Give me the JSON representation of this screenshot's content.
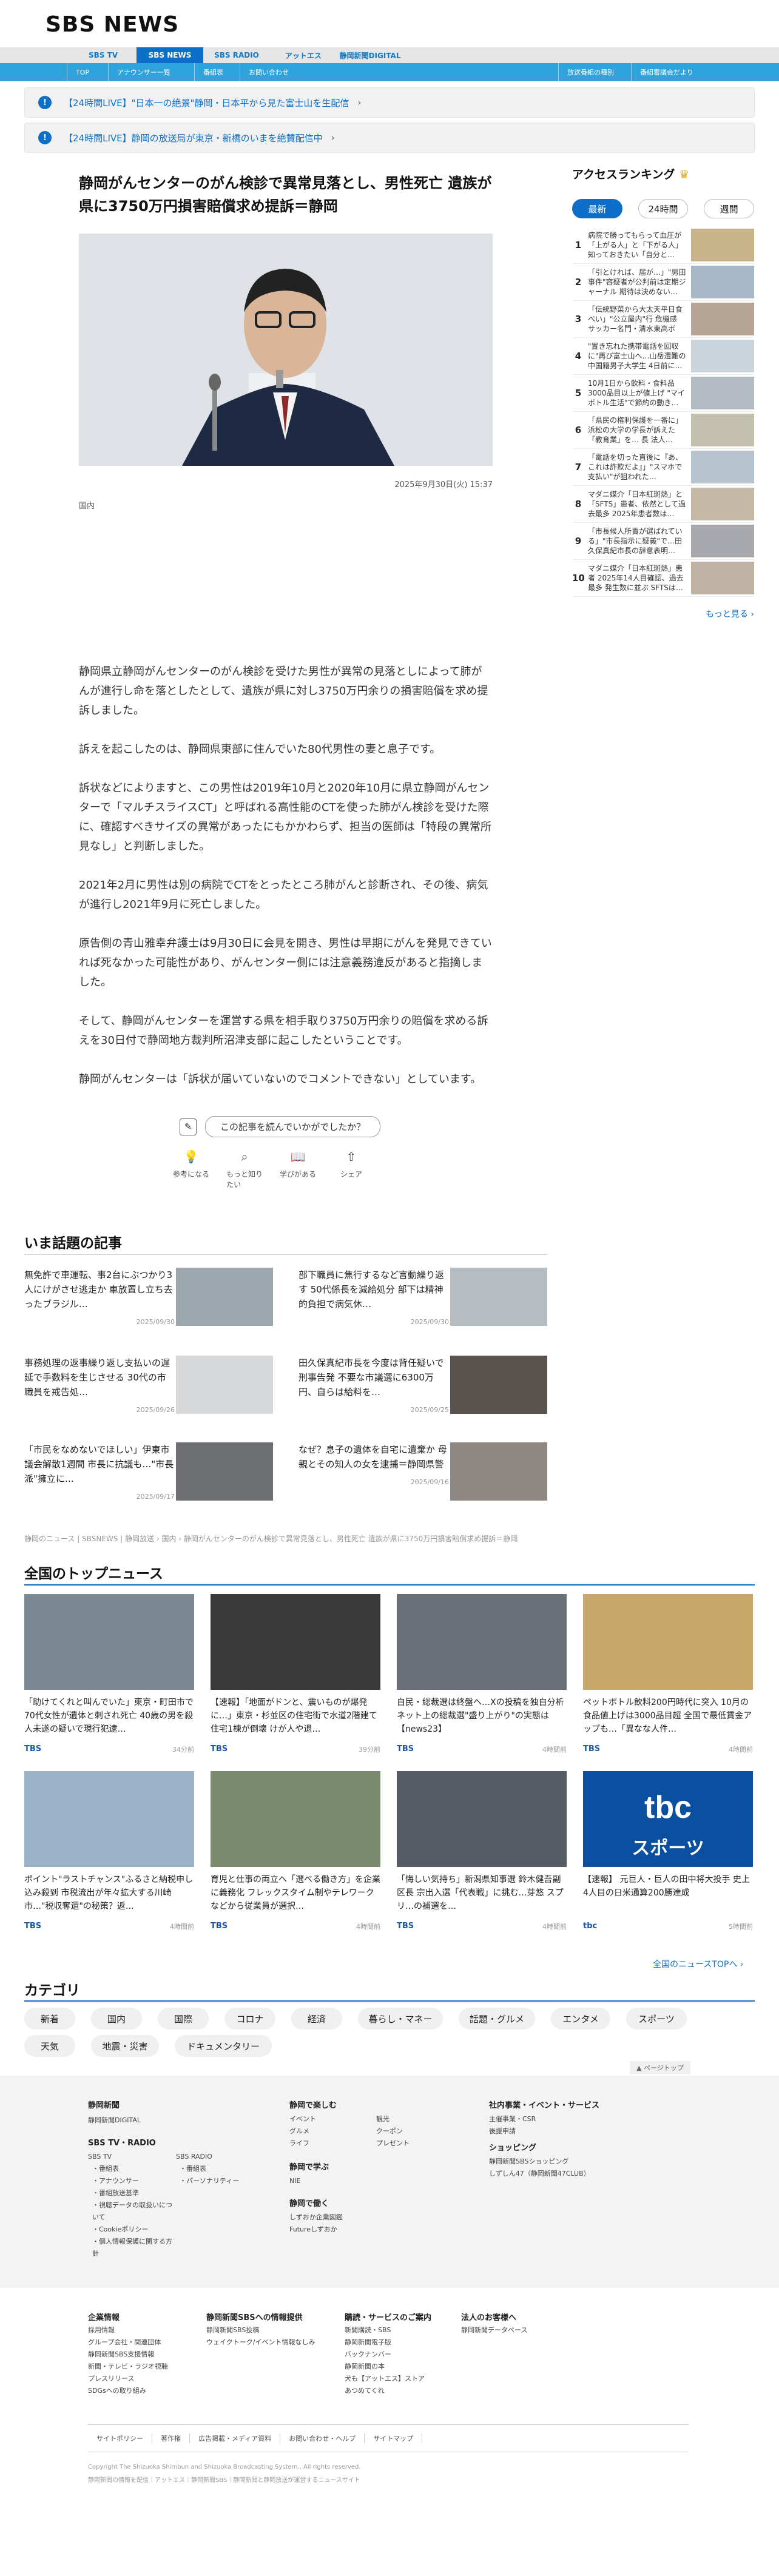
{
  "logo": "SBS NEWS",
  "nav1": [
    "SBS TV",
    "SBS NEWS",
    "SBS RADIO",
    "アットエス",
    "静岡新聞DIGITAL"
  ],
  "nav2": {
    "left": [
      "TOP",
      "アナウンサー一覧",
      "番組表",
      "お問い合わせ"
    ],
    "right": [
      "放送番組の種別",
      "番組審議会だより"
    ]
  },
  "alerts": [
    "【24時間LIVE】\"日本一の絶景\"静岡・日本平から見た富士山を生配信",
    "【24時間LIVE】静岡の放送局が東京・新橋のいまを絶賛配信中"
  ],
  "article": {
    "title": "静岡がんセンターのがん検診で異常見落とし、男性死亡 遺族が県に3750万円損害賠償求め提訴＝静岡",
    "date": "2025年9月30日(火) 15:37",
    "category": "国内",
    "paragraphs": [
      "静岡県立静岡がんセンターのがん検診を受けた男性が異常の見落としによって肺がんが進行し命を落としたとして、遺族が県に対し3750万円余りの損害賠償を求め提訴しました。",
      "訴えを起こしたのは、静岡県東部に住んでいた80代男性の妻と息子です。",
      "訴状などによりますと、この男性は2019年10月と2020年10月に県立静岡がんセンターで「マルチスライスCT」と呼ばれる高性能のCTを使った肺がん検診を受けた際に、確認すべきサイズの異常があったにもかかわらず、担当の医師は「特段の異常所見なし」と判断しました。",
      "2021年2月に男性は別の病院でCTをとったところ肺がんと診断され、その後、病気が進行し2021年9月に死亡しました。",
      "原告側の青山雅幸弁護士は9月30日に会見を開き、男性は早期にがんを発見できていれば死なかった可能性があり、がんセンター側には注意義務違反があると指摘しました。",
      "そして、静岡がんセンターを運営する県を相手取り3750万円余りの賠償を求める訴えを30日付で静岡地方裁判所沼津支部に起こしたということです。",
      "静岡がんセンターは「訴状が届いていないのでコメントできない」としています。"
    ],
    "feedback": "この記事を読んでいかがでしたか？",
    "reactions": [
      "参考になる",
      "もっと知りたい",
      "学びがある",
      "シェア"
    ]
  },
  "ranking": {
    "heading": "アクセスランキング",
    "tabs": [
      "最新",
      "24時間",
      "週間"
    ],
    "items": [
      {
        "no": "1",
        "title": "病院で勝ってもらって血圧が「上がる人」と「下がる人」知っておきたい「自分と…"
      },
      {
        "no": "2",
        "title": "「引とければ、届が…」\"男田事件\"容疑者が公判前は定期ジャーナル 期待は決めない…"
      },
      {
        "no": "3",
        "title": "「伝統野菜から大太天平日食べい」\"公立屋内\"行 危機感 サッカー名門・清水東高ボジ…"
      },
      {
        "no": "4",
        "title": "\"置き忘れた携帯電話を回収に\"再び富士山へ…山岳遭難の中国籍男子大学生 4日前に…"
      },
      {
        "no": "5",
        "title": "10月1日から飲料・食料品3000品目以上が値上げ \"マイボトル生活\"で節約の動き…"
      },
      {
        "no": "6",
        "title": "「県民の権利保護を一番に」浜松の大学の学長が訴えた「教育業」を… 長 法人…"
      },
      {
        "no": "7",
        "title": "「電話を切った直後に『あ、これは詐欺だよ』」\"スマホで支払い\"が狙われた…"
      },
      {
        "no": "8",
        "title": "マダニ媒介「日本紅斑熱」と「SFTS」患者、依然として過去最多 2025年患者数は…"
      },
      {
        "no": "9",
        "title": "「市長候人所責が選ばれている」\"市長指示に疑義\"で…田久保真紀市長の辞意表明…"
      },
      {
        "no": "10",
        "title": "マダニ媒介「日本紅斑熱」患者 2025年14人目確認、過去最多 発生数に並ぶ SFTSは…"
      }
    ],
    "more": "もっと見る ›"
  },
  "hot": {
    "heading": "いま話題の記事",
    "items": [
      {
        "title": "無免許で車運転、事2台にぶつかり3人にけがさせ逃走か 車放置し立ち去ったブラジル…",
        "date": "2025/09/30"
      },
      {
        "title": "部下職員に焦行するなど言動繰り返す 50代係長を減給処分 部下は精神的負担で病気休…",
        "date": "2025/09/30"
      },
      {
        "title": "事務処理の返事繰り返し支払いの遅延で手数料を生じさせる 30代の市職員を戒告処…",
        "date": "2025/09/26"
      },
      {
        "title": "田久保真紀市長を今度は背任疑いで刑事告発 不要な市議選に6300万円、自らは給料を…",
        "date": "2025/09/25"
      },
      {
        "title": "「市民をなめないでほしい」伊東市議会解散1週間 市長に抗議も…\"市長派\"擁立に…",
        "date": "2025/09/17"
      },
      {
        "title": "なぜ？息子の遺体を自宅に遺棄か 母親とその知人の女を逮捕＝静岡県警",
        "date": "2025/09/16"
      }
    ]
  },
  "breadcrumb": "静岡のニュース | SBSNEWS | 静岡放送 › 国内 › 静岡がんセンターのがん検診で異常見落とし、男性死亡 遺族が県に3750万円損害賠償求め提訴＝静岡",
  "topnews": {
    "heading": "全国のトップニュース",
    "items": [
      {
        "title": "「助けてくれと叫んでいた」東京・町田市で70代女性が遺体と刺され死亡 40歳の男を殺人未遂の疑いで現行犯逮…",
        "src": "TBS",
        "ago": "34分前"
      },
      {
        "title": "【速報】「地面がドンと、震いものが爆発に…」東京・杉並区の住宅街で水道2階建て住宅1棟が倒壊 けが人や退…",
        "src": "TBS",
        "ago": "39分前"
      },
      {
        "title": "自民・総裁選は終盤へ…Xの投稿を独自分析 ネット上の総裁選\"盛り上がり\"の実態は【news23】",
        "src": "TBS",
        "ago": "4時間前"
      },
      {
        "title": "ペットボトル飲料200円時代に突入 10月の食品値上げは3000品目超 全国で最低賃金アップも…「異なな人件…",
        "src": "TBS",
        "ago": "4時間前"
      },
      {
        "title": "ポイント\"ラストチャンス\"ふるさと納税申し込み殺到 市税流出が年々拡大する川崎市…\"税収奪還\"の秘策？返…",
        "src": "TBS",
        "ago": "4時間前"
      },
      {
        "title": "育児と仕事の両立へ「選べる働き方」を企業に義務化 フレックスタイム制やテレワークなどから従業員が選択…",
        "src": "TBS",
        "ago": "4時間前"
      },
      {
        "title": "「悔しい気持ち」新潟県知事選 鈴木健吾副区長 宗出入選「代表戦」に挑む…芽悠 スプリ…の補選を…",
        "src": "TBS",
        "ago": "4時間前"
      },
      {
        "title": "【速報】 元巨人・巨人の田中将大投手 史上4人目の日米通算200勝達成",
        "src": "tbc",
        "ago": "5時間前"
      }
    ],
    "all": "全国のニュースTOPへ ›"
  },
  "categories": {
    "heading": "カテゴリ",
    "items": [
      "新着",
      "国内",
      "国際",
      "コロナ",
      "経済",
      "暮らし・マネー",
      "話題・グルメ",
      "エンタメ",
      "スポーツ",
      "天気",
      "地震・災害",
      "ドキュメンタリー"
    ]
  },
  "pagetop": "▲ ページトップ",
  "footer1": {
    "shizuoka": {
      "h": "静岡新聞",
      "a": "静岡新聞DIGITAL"
    },
    "sbs": {
      "h": "SBS TV・RADIO",
      "tv": "SBS TV",
      "tvitems": [
        "・番組表",
        "・アナウンサー",
        "・番組放送基準",
        "・視聴データの取扱いについて",
        "・Cookieポリシー",
        "・個人情報保護に関する方針"
      ],
      "radio": "SBS RADIO",
      "radioitems": [
        "・番組表",
        "・パーソナリティー"
      ]
    },
    "enjoy": {
      "h": "静岡で楽しむ",
      "items": [
        "イベント",
        "グルメ",
        "ライフ",
        "観光",
        "クーポン",
        "プレゼント"
      ]
    },
    "learn": {
      "h": "静岡で学ぶ",
      "items": [
        "NIE"
      ]
    },
    "work": {
      "h": "静岡で働く",
      "items": [
        "しずおか企業図鑑",
        "Futureしずおか"
      ]
    },
    "events": {
      "h": "社内事業・イベント・サービス",
      "items": [
        "主催事業・CSR",
        "後援申請"
      ]
    },
    "shop": {
      "h": "ショッピング",
      "items": [
        "静岡新聞SBSショッピング",
        "しずしん47（静岡新聞47CLUB）"
      ]
    }
  },
  "footer2": {
    "corp": {
      "h": "企業情報",
      "items": [
        "採用情報",
        "グループ会社・関連団体",
        "静岡新聞SBS支援情報",
        "新聞・テレビ・ラジオ視聴",
        "プレスリリース",
        "SDGsへの取り組み"
      ]
    },
    "promo": {
      "h": "静岡新聞SBSへの情報提供",
      "items": [
        "静岡新聞SBS投稿",
        "ウェイクトーク/イベント情報なしみ"
      ]
    },
    "svc": {
      "h": "購読・サービスのご案内",
      "items": [
        "新聞購読・SBS",
        "静岡新聞電子版",
        "バックナンバー",
        "静岡新聞の本",
        "犬も【アットエス】ストア",
        "あつめてくれ"
      ]
    },
    "biz": {
      "h": "法人のお客様へ",
      "items": [
        "静岡新聞データベース"
      ]
    },
    "links": [
      "サイトポリシー",
      "著作権",
      "広告掲載・メディア資料",
      "お問い合わせ・ヘルプ",
      "サイトマップ"
    ],
    "copy1": "Copyright The Shizuoka Shimbun and Shizuoka Broadcasting System., All rights reserved.",
    "copy2": "静岡新聞の情報を配信｜アットエス｜静岡新聞SBS｜静岡新聞と静岡放送が運営するニュースサイト"
  }
}
